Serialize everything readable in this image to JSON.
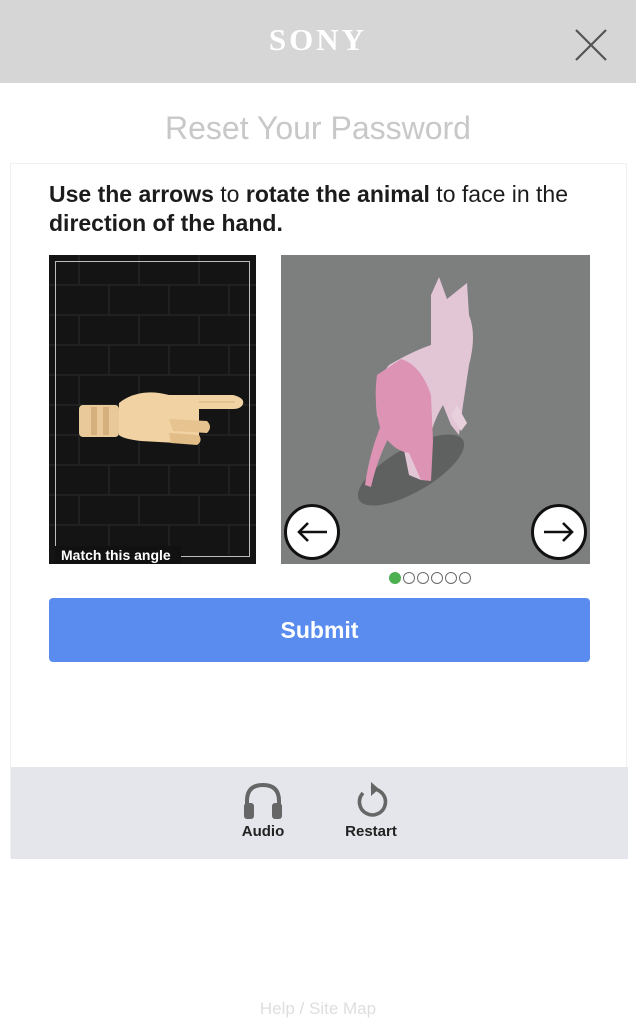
{
  "header": {
    "logo": "SONY",
    "close_icon": "close-icon"
  },
  "page": {
    "title": "Reset Your Password"
  },
  "challenge": {
    "instruction": {
      "part1": "Use the arrows",
      "part2": " to ",
      "part3": "rotate the animal",
      "part4": " to face in the ",
      "part5": "direction of the hand."
    },
    "reference_caption": "Match this angle",
    "left_arrow_icon": "arrow-left-icon",
    "right_arrow_icon": "arrow-right-icon",
    "progress": {
      "current": 1,
      "total": 6
    },
    "submit_label": "Submit"
  },
  "tools": {
    "audio_label": "Audio",
    "audio_icon": "headphones-icon",
    "restart_label": "Restart",
    "restart_icon": "restart-icon"
  },
  "footer": {
    "help_link": "Help / Site Map"
  },
  "colors": {
    "header_bg": "#d6d6d6",
    "submit_bg": "#5a8cf0",
    "active_dot": "#4caf50",
    "tools_bar_bg": "#e4e6ec"
  }
}
